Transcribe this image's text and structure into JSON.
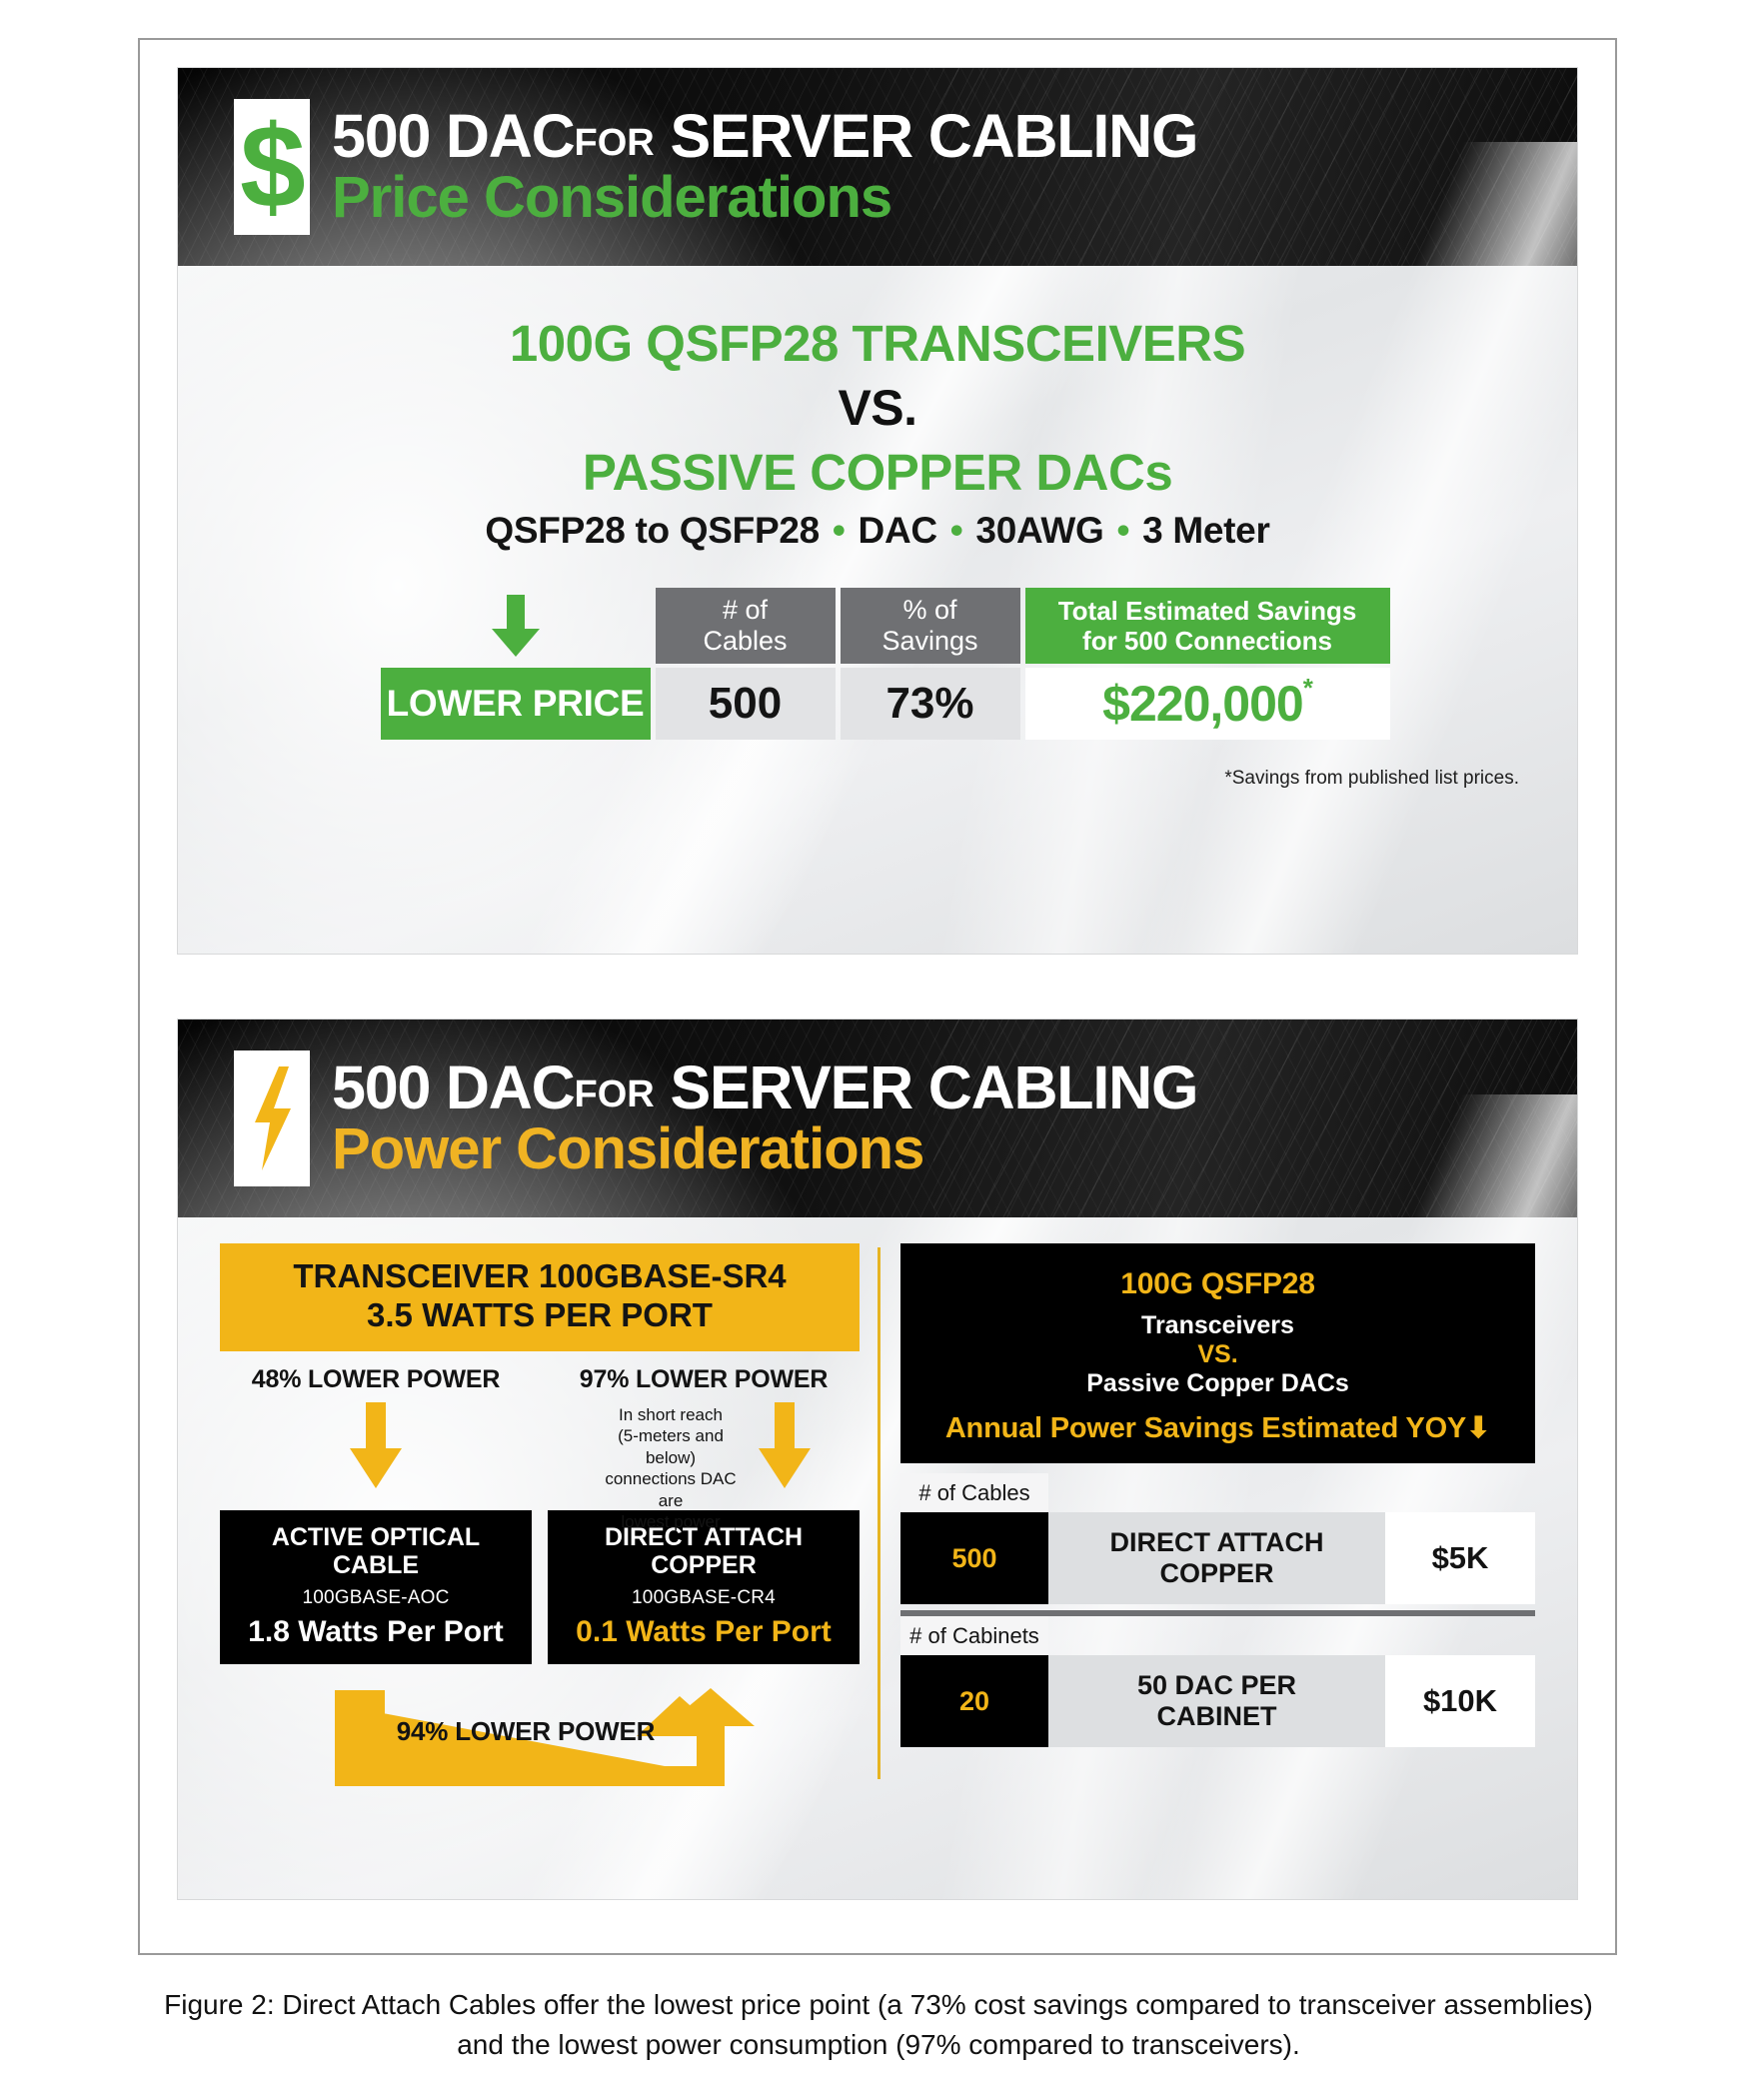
{
  "colors": {
    "green": "#4caf3f",
    "gold": "#f2b518",
    "black": "#000000",
    "grey_header": "#6f7073"
  },
  "price_panel": {
    "header": {
      "badge_icon": "dollar-sign-icon",
      "line1_main": "500 DAC",
      "line1_for": "FOR",
      "line1_tail": "SERVER CABLING",
      "line2": "Price Considerations"
    },
    "comparison": {
      "top": "100G QSFP28 TRANSCEIVERS",
      "middle": "VS.",
      "bottom": "PASSIVE COPPER DACs",
      "spec_parts": [
        "QSFP28 to QSFP28",
        "DAC",
        "30AWG",
        "3 Meter"
      ],
      "spec_separator": "•"
    },
    "table": {
      "arrow_icon": "arrow-down-icon",
      "headers": [
        "# of\nCables",
        "% of\nSavings",
        "Total Estimated Savings\nfor 500 Connections"
      ],
      "header_cables_line1": "# of",
      "header_cables_line2": "Cables",
      "header_savings_line1": "% of",
      "header_savings_line2": "Savings",
      "header_total_line1": "Total Estimated Savings",
      "header_total_line2": "for 500 Connections",
      "row_label": "LOWER PRICE",
      "cables_value": "500",
      "savings_value": "73%",
      "total_value": "$220,000",
      "total_superscript": "*"
    },
    "footnote": "*Savings from published list prices."
  },
  "power_panel": {
    "header": {
      "badge_icon": "lightning-bolt-icon",
      "line1_main": "500 DAC",
      "line1_for": "FOR",
      "line1_tail": "SERVER CABLING",
      "line2": "Power Considerations"
    },
    "transceiver_banner_line1": "TRANSCEIVER 100GBASE-SR4",
    "transceiver_banner_line2": "3.5 WATTS PER PORT",
    "lower_power_left": "48% LOWER POWER",
    "lower_power_right": "97% LOWER POWER",
    "short_reach_note": "In short reach (5-meters and below) connections DAC are lowest power",
    "short_reach_note_lines": [
      "In short reach",
      "(5-meters and below)",
      "connections DAC are",
      "lowest power"
    ],
    "cables": [
      {
        "name_line1": "ACTIVE OPTICAL",
        "name_line2": "CABLE",
        "standard": "100GBASE-AOC",
        "watts": "1.8 Watts Per Port",
        "watts_highlight": false
      },
      {
        "name_line1": "DIRECT ATTACH",
        "name_line2": "COPPER",
        "standard": "100GBASE-CR4",
        "watts": "0.1 Watts Per Port",
        "watts_highlight": true
      }
    ],
    "loop_label": "94% LOWER POWER",
    "summary": {
      "title": "100G QSFP28",
      "sub1": "Transceivers",
      "vs": "VS.",
      "sub2": "Passive Copper DACs",
      "yoy": "Annual Power Savings Estimated YOY",
      "yoy_arrow": "⬇",
      "rows": [
        {
          "head": "# of Cables",
          "count": "500",
          "desc_line1": "DIRECT ATTACH",
          "desc_line2": "COPPER",
          "cost": "$5K"
        },
        {
          "head": "# of Cabinets",
          "count": "20",
          "desc_line1": "50 DAC PER",
          "desc_line2": "CABINET",
          "cost": "$10K"
        }
      ]
    }
  },
  "caption": {
    "line1": "Figure 2: Direct Attach Cables offer the lowest price point (a 73% cost savings compared to transceiver assemblies)",
    "line2": "and the lowest power consumption (97% compared to transceivers)."
  }
}
